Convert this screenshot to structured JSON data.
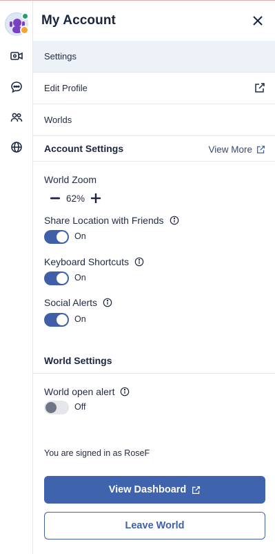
{
  "header": {
    "title": "My Account"
  },
  "nav": [
    {
      "label": "Settings",
      "active": true
    },
    {
      "label": "Edit Profile",
      "external": true
    },
    {
      "label": "Worlds"
    }
  ],
  "account_settings": {
    "title": "Account Settings",
    "view_more": "View More",
    "zoom": {
      "label": "World Zoom",
      "value": "62%"
    },
    "toggles": [
      {
        "label": "Share Location with Friends",
        "state": "On"
      },
      {
        "label": "Keyboard Shortcuts",
        "state": "On"
      },
      {
        "label": "Social Alerts",
        "state": "On"
      }
    ]
  },
  "world_settings": {
    "title": "World Settings",
    "toggles": [
      {
        "label": "World open alert",
        "state": "Off"
      }
    ]
  },
  "signed_in_text": "You are signed in as RoseF",
  "buttons": {
    "dashboard": "View Dashboard",
    "leave": "Leave World"
  },
  "colors": {
    "accent": "#3f63ad",
    "presence": "#1fa463",
    "badge": "#f2a533",
    "active_row": "#edf1f8"
  },
  "icons": [
    "avatar",
    "video-camera-icon",
    "chat-icon",
    "people-icon",
    "globe-icon",
    "close-icon",
    "external-link-icon",
    "info-icon",
    "minus-icon",
    "plus-icon"
  ]
}
